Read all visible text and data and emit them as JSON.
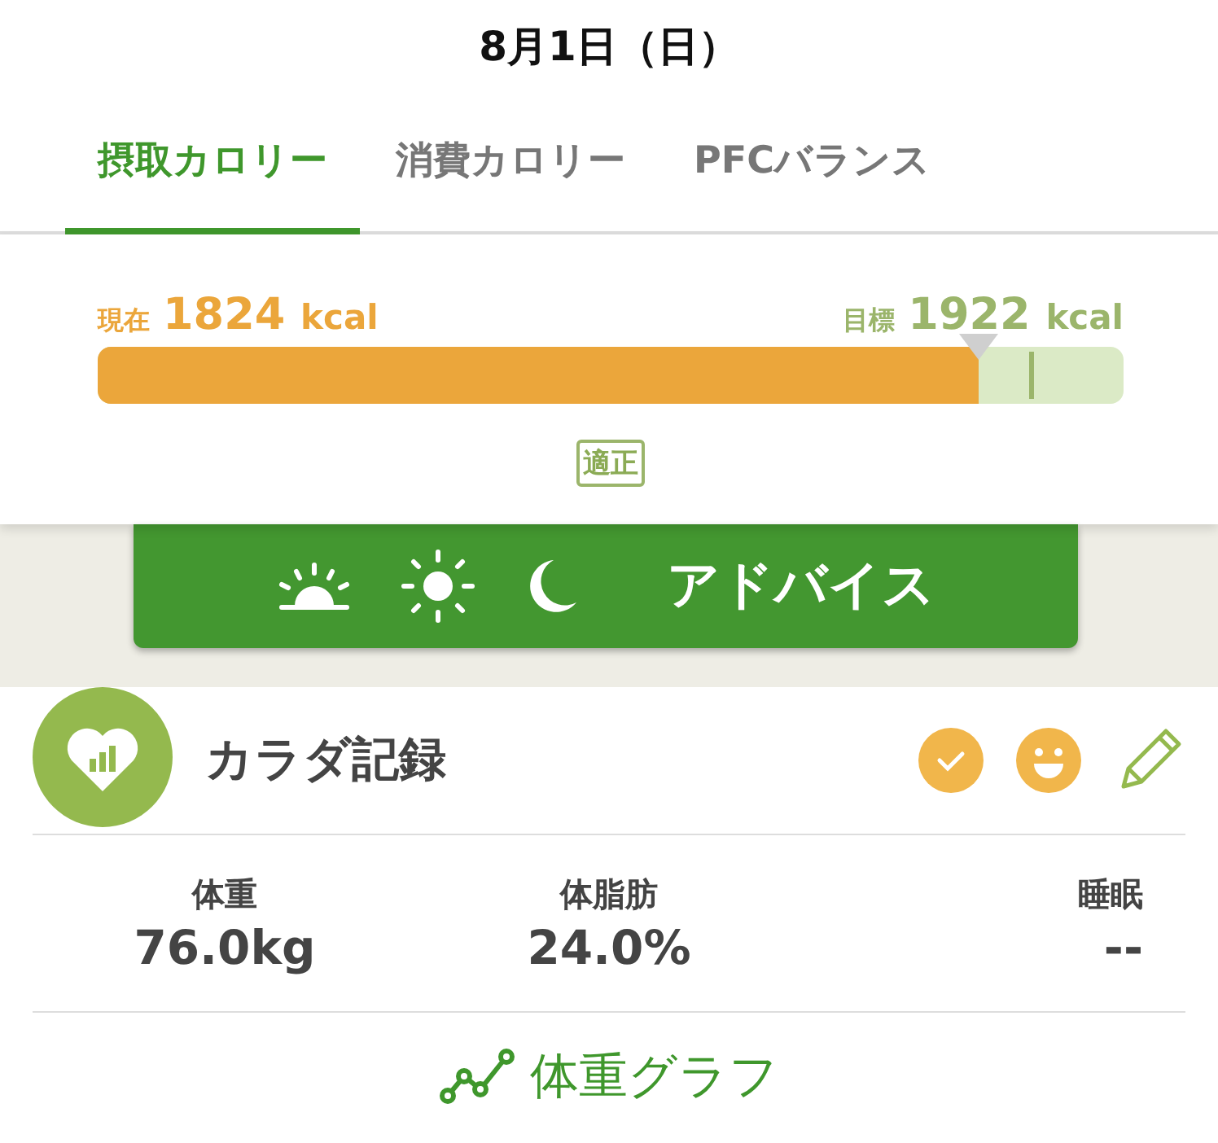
{
  "header": {
    "date": "8月1日（日）"
  },
  "tabs": [
    {
      "label": "摂取カロリー",
      "selected": true
    },
    {
      "label": "消費カロリー",
      "selected": false
    },
    {
      "label": "PFCバランス",
      "selected": false
    }
  ],
  "calorie": {
    "current_label": "現在",
    "current_value": "1824",
    "current_unit": "kcal",
    "target_label": "目標",
    "target_value": "1922",
    "target_unit": "kcal",
    "level": 0.859,
    "target": {
      "level": 0.908
    },
    "status": "適正"
  },
  "advice_button": {
    "label": "アドバイス"
  },
  "body_record": {
    "title": "カラダ記録",
    "metrics": [
      {
        "label": "体重",
        "value": "76.0kg"
      },
      {
        "label": "体脂肪",
        "value": "24.0%"
      },
      {
        "label": "睡眠",
        "value": "--"
      }
    ],
    "graph_link": "体重グラフ"
  }
}
